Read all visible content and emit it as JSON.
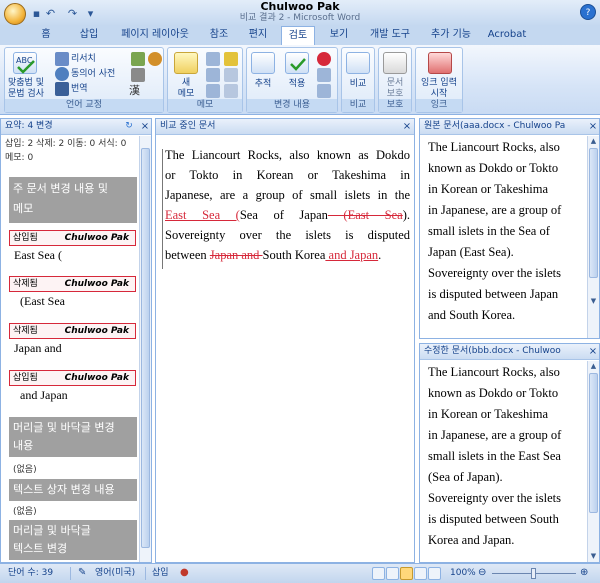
{
  "window": {
    "author": "Chulwoo Pak",
    "doc_title": "비교 결과 2 - Microsoft Word",
    "help": "?"
  },
  "ribbon_tabs": [
    "홈",
    "삽입",
    "페이지 레이아웃",
    "참조",
    "편지",
    "검토",
    "보기",
    "개발 도구",
    "추가 기능",
    "Acrobat"
  ],
  "ribbon": {
    "proofing": {
      "label": "언어 교정",
      "spell_line1": "맞춤법 및",
      "spell_line2": "문법 검사",
      "research": "리서치",
      "thesaurus": "동의어 사전",
      "translate": "번역"
    },
    "comments": {
      "label": "메모",
      "new_line1": "새",
      "new_line2": "메모"
    },
    "tracking": {
      "label": "변경 내용",
      "track": "추적",
      "accept": "적용"
    },
    "compare": {
      "label": "비교",
      "compare": "비교"
    },
    "protect": {
      "label": "보호",
      "protect_line1": "문서",
      "protect_line2": "보호"
    },
    "ink": {
      "label": "잉크",
      "ink_line1": "잉크 입력",
      "ink_line2": "시작"
    }
  },
  "revisions_pane": {
    "header": "요약: 4 변경",
    "stats_line1": "삽입: 2 삭제: 2 이동: 0 서식: 0",
    "stats_line2": "메모: 0",
    "main_group_line1": "주 문서 변경 내용 및",
    "main_group_line2": "메모",
    "items": [
      {
        "type": "삽입됨",
        "author": "Chulwoo Pak",
        "text": "East Sea ("
      },
      {
        "type": "삭제됨",
        "author": "Chulwoo Pak",
        "text": "(East Sea"
      },
      {
        "type": "삭제됨",
        "author": "Chulwoo Pak",
        "text": "Japan and"
      },
      {
        "type": "삽입됨",
        "author": "Chulwoo Pak",
        "text": "and Japan"
      }
    ],
    "header_footer_line1": "머리글 및 바닥글 변경",
    "header_footer_line2": "내용",
    "none_1": "(없음)",
    "textbox_group": "텍스트 상자 변경 내용",
    "none_2": "(없음)",
    "hf_textbox_line1": "머리글 및 바닥글",
    "hf_textbox_line2": "텍스트 변경"
  },
  "compared_doc": {
    "header": "비교 중인 문서",
    "lines": [
      {
        "segments": [
          {
            "t": "The Liancourt Rocks, also known as Dokdo",
            "s": "n"
          }
        ]
      },
      {
        "segments": [
          {
            "t": "or Tokto in Korean or Takeshima in",
            "s": "n"
          }
        ]
      },
      {
        "segments": [
          {
            "t": "Japanese, are a group of small islets in the",
            "s": "n"
          }
        ]
      },
      {
        "segments": [
          {
            "t": "East Sea (",
            "s": "ins"
          },
          {
            "t": "Sea of Japan",
            "s": "n"
          },
          {
            "t": " (East Sea",
            "s": "del"
          },
          {
            "t": ").",
            "s": "n"
          }
        ]
      },
      {
        "segments": [
          {
            "t": "Sovereignty over the islets is disputed",
            "s": "n"
          }
        ]
      },
      {
        "segments": [
          {
            "t": "between ",
            "s": "n"
          },
          {
            "t": "Japan and ",
            "s": "del"
          },
          {
            "t": "South Korea",
            "s": "n"
          },
          {
            "t": " and Japan",
            "s": "ins"
          },
          {
            "t": ".",
            "s": "n"
          }
        ]
      }
    ]
  },
  "original_doc": {
    "header": "원본 문서(aaa.docx - Chulwoo Pa",
    "lines": [
      "The Liancourt Rocks, also",
      "known as Dokdo or Tokto",
      "in Korean or Takeshima",
      "in Japanese, are a group of",
      "small islets in the Sea of",
      "Japan (East Sea).",
      "Sovereignty over the islets",
      "is disputed between Japan",
      "and South Korea."
    ]
  },
  "revised_doc": {
    "header": "수정한 문서(bbb.docx - Chulwoo",
    "lines": [
      "The Liancourt Rocks, also",
      "known as Dokdo or Tokto",
      "in Korean or Takeshima",
      "in Japanese, are a group of",
      "small islets in the East Sea",
      "(Sea of Japan).",
      "Sovereignty over the islets",
      "is disputed between South",
      "Korea and Japan."
    ]
  },
  "status_bar": {
    "word_count": "단어 수: 39",
    "language": "영어(미국)",
    "mode": "삽입",
    "zoom": "100%"
  },
  "colors": {
    "insert_delete": "#d6283a",
    "ribbon_blue": "#c4d8f0",
    "accent_text": "#15428b"
  }
}
